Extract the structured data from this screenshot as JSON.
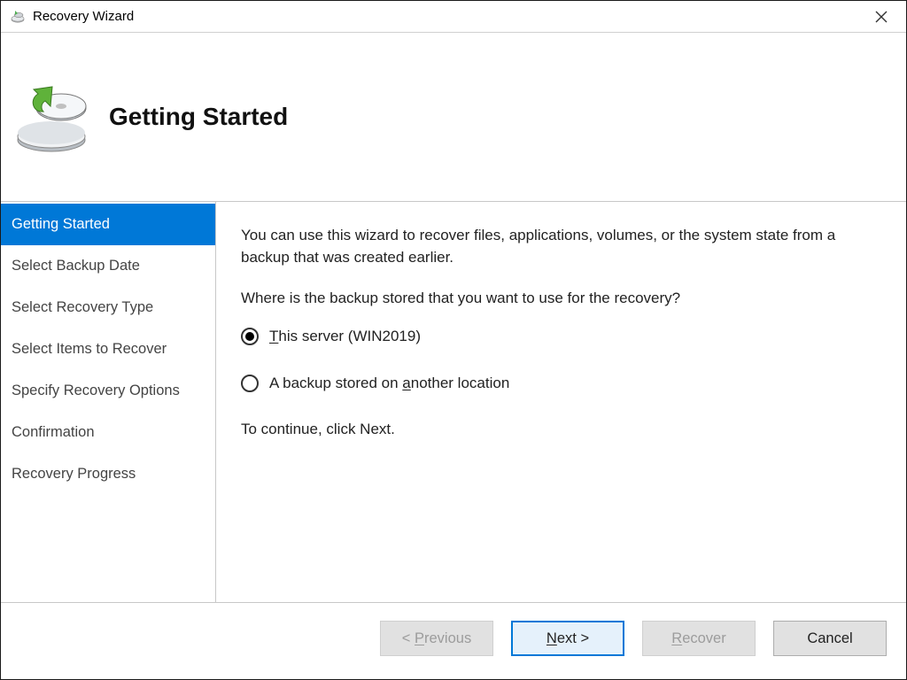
{
  "window": {
    "title": "Recovery Wizard",
    "close_label": "✕"
  },
  "header": {
    "title": "Getting Started"
  },
  "sidebar": {
    "steps": [
      "Getting Started",
      "Select Backup Date",
      "Select Recovery Type",
      "Select Items to Recover",
      "Specify Recovery Options",
      "Confirmation",
      "Recovery Progress"
    ],
    "active_index": 0
  },
  "content": {
    "intro": "You can use this wizard to recover files, applications, volumes, or the system state from a backup that was created earlier.",
    "question": "Where is the backup stored that you want to use for the recovery?",
    "option_this_server_pre": "T",
    "option_this_server_post": "his server (WIN2019)",
    "option_another_pre": "A backup stored on ",
    "option_another_mid": "a",
    "option_another_post": "nother location",
    "continue": "To continue, click Next."
  },
  "footer": {
    "previous_pre": "< ",
    "previous_u": "P",
    "previous_post": "revious",
    "next_u": "N",
    "next_post": "ext >",
    "recover_u": "R",
    "recover_post": "ecover",
    "cancel": "Cancel"
  }
}
